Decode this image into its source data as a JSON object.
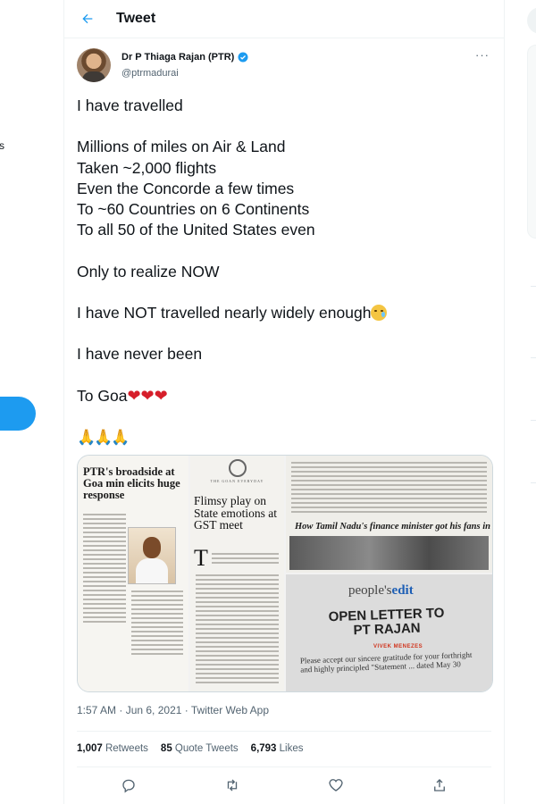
{
  "left_nav": {
    "partial_letter": "s"
  },
  "header": {
    "back_icon": "back-arrow-icon",
    "title": "Tweet"
  },
  "tweet": {
    "author_name": "Dr P Thiaga Rajan (PTR)",
    "handle": "@ptrmadurai",
    "verified": true,
    "more_label": "···",
    "lines": [
      "I have travelled",
      "Millions of miles on Air & Land",
      "Taken ~2,000 flights",
      "Even the Concorde a few times",
      "To ~60 Countries on 6 Continents",
      "To all 50 of the United States even",
      "Only to realize NOW",
      "I have NOT travelled nearly widely enough",
      "I have never been",
      "To Goa",
      "🙏🙏🙏"
    ],
    "hearts": "❤❤❤",
    "timestamp": "1:57 AM · Jun 6, 2021 · Twitter Web App",
    "stats": {
      "retweets_count": "1,007",
      "retweets_label": "Retweets",
      "quotes_count": "85",
      "quotes_label": "Quote Tweets",
      "likes_count": "6,793",
      "likes_label": "Likes"
    }
  },
  "media": {
    "clip1_headline": "PTR's broadside at Goa min elicits huge response",
    "clip2_masthead": "THE GOAN EVERYDAY",
    "clip2_headline": "Flimsy play on State emotions at GST meet",
    "clip2_dropcap": "T",
    "clip3_caption": "How Tamil Nadu's finance minister got his fans in Goa",
    "clip4_section_a": "people's",
    "clip4_section_b": "edit",
    "clip4_headline_1": "OPEN LETTER TO",
    "clip4_headline_2": "PT RAJAN",
    "clip4_byline": "VIVEK MENEZES",
    "clip4_body": "Please accept our sincere gratitude for your forthright and highly principled \"Statement ... dated May 30"
  },
  "colors": {
    "accent": "#1d9bf0",
    "text": "#0f1419",
    "secondary": "#536471",
    "border": "#eff3f4",
    "heart": "#d61e2a"
  }
}
